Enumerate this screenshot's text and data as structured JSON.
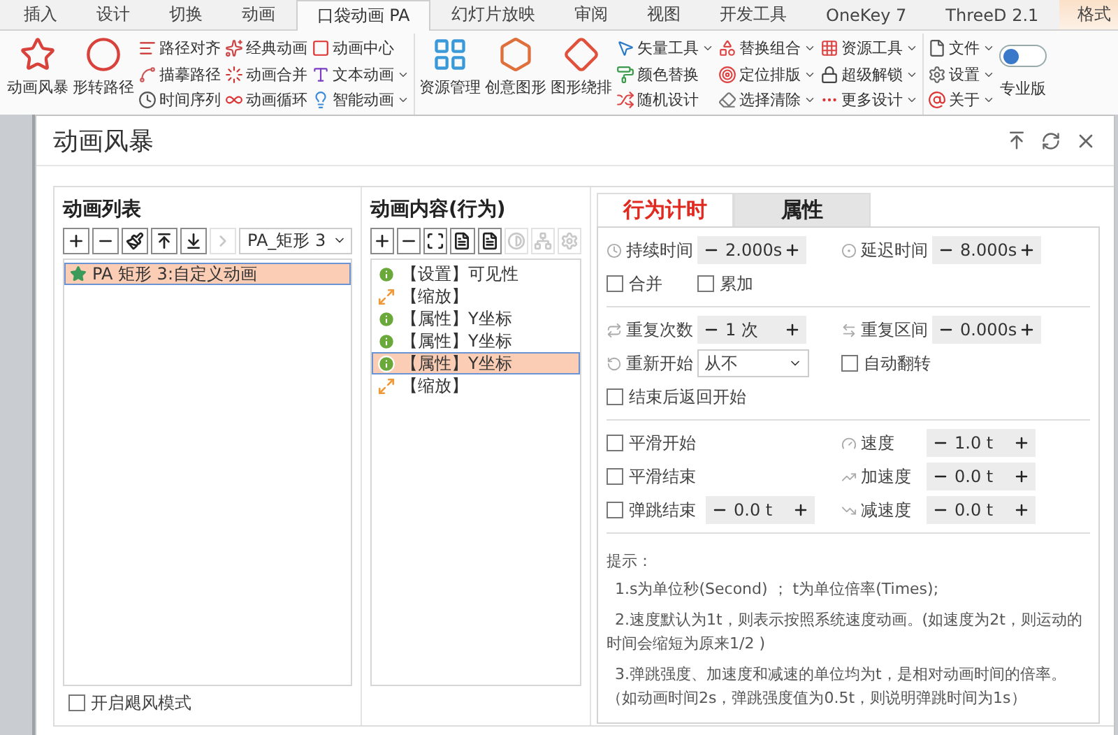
{
  "ribbon_tabs": [
    {
      "label": "插入",
      "selected": false,
      "kind": "normal"
    },
    {
      "label": "设计",
      "selected": false,
      "kind": "normal"
    },
    {
      "label": "切换",
      "selected": false,
      "kind": "normal"
    },
    {
      "label": "动画",
      "selected": false,
      "kind": "normal"
    },
    {
      "label": "口袋动画 PA",
      "selected": true,
      "kind": "normal"
    },
    {
      "label": "幻灯片放映",
      "selected": false,
      "kind": "normal"
    },
    {
      "label": "审阅",
      "selected": false,
      "kind": "normal"
    },
    {
      "label": "视图",
      "selected": false,
      "kind": "normal"
    },
    {
      "label": "开发工具",
      "selected": false,
      "kind": "normal"
    },
    {
      "label": "OneKey 7",
      "selected": false,
      "kind": "normal"
    },
    {
      "label": "ThreeD 2.1",
      "selected": false,
      "kind": "normal"
    },
    {
      "label": "格式",
      "selected": false,
      "kind": "contextual"
    }
  ],
  "ribbon": {
    "groups": [
      {
        "columns": [
          {
            "kind": "large",
            "label": "动画风暴"
          },
          {
            "kind": "large",
            "label": "形转路径"
          },
          {
            "kind": "stack",
            "items": [
              {
                "label": "路径对齐",
                "dropdown": false
              },
              {
                "label": "描摹路径",
                "dropdown": false
              },
              {
                "label": "时间序列",
                "dropdown": false
              }
            ]
          },
          {
            "kind": "stack",
            "items": [
              {
                "label": "经典动画",
                "dropdown": false
              },
              {
                "label": "动画合并",
                "dropdown": false
              },
              {
                "label": "动画循环",
                "dropdown": false
              }
            ]
          },
          {
            "kind": "stack",
            "items": [
              {
                "label": "动画中心",
                "dropdown": false
              },
              {
                "label": "文本动画",
                "dropdown": true
              },
              {
                "label": "智能动画",
                "dropdown": true
              }
            ]
          }
        ]
      },
      {
        "columns": [
          {
            "kind": "large",
            "label": "资源管理"
          },
          {
            "kind": "large",
            "label": "创意图形"
          },
          {
            "kind": "large",
            "label": "图形绕排"
          },
          {
            "kind": "stack",
            "items": [
              {
                "label": "矢量工具",
                "dropdown": true
              },
              {
                "label": "颜色替换",
                "dropdown": false
              },
              {
                "label": "随机设计",
                "dropdown": false
              }
            ]
          },
          {
            "kind": "stack",
            "items": [
              {
                "label": "替换组合",
                "dropdown": true
              },
              {
                "label": "定位排版",
                "dropdown": true
              },
              {
                "label": "选择清除",
                "dropdown": true
              }
            ]
          },
          {
            "kind": "stack",
            "items": [
              {
                "label": "资源工具",
                "dropdown": true
              },
              {
                "label": "超级解锁",
                "dropdown": true
              },
              {
                "label": "更多设计",
                "dropdown": true
              }
            ]
          }
        ]
      },
      {
        "columns": [
          {
            "kind": "stack",
            "items": [
              {
                "label": "文件",
                "dropdown": true
              },
              {
                "label": "设置",
                "dropdown": true
              },
              {
                "label": "关于",
                "dropdown": true
              }
            ]
          },
          {
            "kind": "toggle",
            "label": "专业版",
            "on": false
          }
        ]
      }
    ]
  },
  "dialog": {
    "title": "动画风暴",
    "animation_list": {
      "title": "动画列表",
      "toolbar": [
        {
          "disabled": false
        },
        {
          "disabled": false
        },
        {
          "disabled": false
        },
        {
          "disabled": false
        },
        {
          "disabled": false
        },
        {
          "disabled": true
        }
      ],
      "target": "PA_矩形 3",
      "items": [
        {
          "label": "PA  矩形 3:自定义动画",
          "selected": true
        }
      ],
      "storm_mode": {
        "label": "开启飓风模式",
        "checked": false
      }
    },
    "content": {
      "title": "动画内容(行为)",
      "toolbar": [
        {
          "disabled": false
        },
        {
          "disabled": false
        },
        {
          "disabled": false
        },
        {
          "disabled": false
        },
        {
          "disabled": false
        },
        {
          "disabled": true
        },
        {
          "disabled": true
        },
        {
          "disabled": true
        }
      ],
      "items": [
        {
          "kind": "info",
          "label": "【设置】可见性",
          "selected": false
        },
        {
          "kind": "scale",
          "label": "【缩放】",
          "selected": false
        },
        {
          "kind": "info",
          "label": "【属性】Y坐标",
          "selected": false
        },
        {
          "kind": "info",
          "label": "【属性】Y坐标",
          "selected": false
        },
        {
          "kind": "info",
          "label": "【属性】Y坐标",
          "selected": true
        },
        {
          "kind": "scale",
          "label": "【缩放】",
          "selected": false
        }
      ]
    },
    "tabs": [
      {
        "label": "行为计时",
        "selected": true
      },
      {
        "label": "属性",
        "selected": false
      }
    ],
    "timing": {
      "duration": {
        "label": "持续时间",
        "value": "2.000s"
      },
      "delay": {
        "label": "延迟时间",
        "value": "8.000s"
      },
      "merge": {
        "label": "合并",
        "checked": false
      },
      "accumulate": {
        "label": "累加",
        "checked": false
      },
      "repeat_count": {
        "label": "重复次数",
        "value": "1 次"
      },
      "repeat_interval": {
        "label": "重复区间",
        "value": "0.000s"
      },
      "restart": {
        "label": "重新开始",
        "value": "从不"
      },
      "auto_reverse": {
        "label": "自动翻转",
        "checked": false
      },
      "rewind": {
        "label": "结束后返回开始",
        "checked": false
      },
      "smooth_start": {
        "label": "平滑开始",
        "checked": false
      },
      "smooth_end": {
        "label": "平滑结束",
        "checked": false
      },
      "bounce_end": {
        "label": "弹跳结束",
        "checked": false,
        "value": "0.0 t"
      },
      "speed": {
        "label": "速度",
        "value": "1.0 t"
      },
      "acceleration": {
        "label": "加速度",
        "value": "0.0 t"
      },
      "deceleration": {
        "label": "减速度",
        "value": "0.0 t"
      }
    },
    "hints": {
      "title": "提示：",
      "lines": [
        "1.s为单位秒(Second) ； t为单位倍率(Times);",
        "2.速度默认为1t，则表示按照系统速度动画。(如速度为2t，则运动的时间会缩短为原来1/2 )",
        "3.弹跳强度、加速度和减速的单位均为t，是相对动画时间的倍率。（如动画时间2s，弹跳强度值为0.5t，则说明弹跳时间为1s）"
      ]
    }
  }
}
